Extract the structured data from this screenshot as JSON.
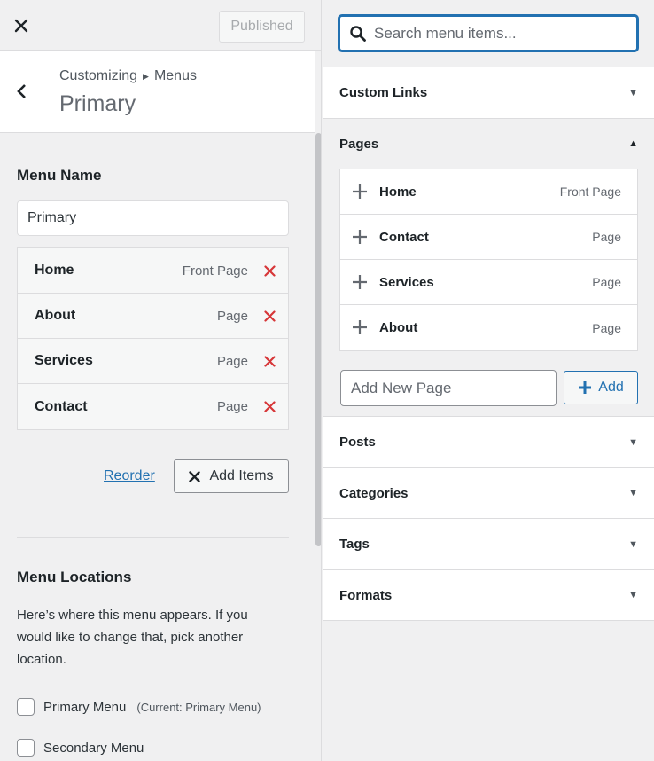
{
  "topbar": {
    "published_label": "Published"
  },
  "header": {
    "breadcrumb_root": "Customizing",
    "breadcrumb_current": "Menus",
    "title": "Primary"
  },
  "menu_name": {
    "heading": "Menu Name",
    "value": "Primary"
  },
  "menu_items": [
    {
      "label": "Home",
      "type": "Front Page"
    },
    {
      "label": "About",
      "type": "Page"
    },
    {
      "label": "Services",
      "type": "Page"
    },
    {
      "label": "Contact",
      "type": "Page"
    }
  ],
  "actions": {
    "reorder_label": "Reorder",
    "add_items_label": "Add Items"
  },
  "locations": {
    "heading": "Menu Locations",
    "description": "Here’s where this menu appears. If you would like to change that, pick another location.",
    "options": [
      {
        "label": "Primary Menu",
        "sub": "(Current: Primary Menu)"
      },
      {
        "label": "Secondary Menu",
        "sub": ""
      }
    ]
  },
  "search": {
    "placeholder": "Search menu items..."
  },
  "panels": {
    "custom_links": "Custom Links",
    "pages": "Pages",
    "posts": "Posts",
    "categories": "Categories",
    "tags": "Tags",
    "formats": "Formats"
  },
  "available_pages": [
    {
      "label": "Home",
      "type": "Front Page"
    },
    {
      "label": "Contact",
      "type": "Page"
    },
    {
      "label": "Services",
      "type": "Page"
    },
    {
      "label": "About",
      "type": "Page"
    }
  ],
  "new_page": {
    "placeholder": "Add New Page",
    "add_label": "Add"
  },
  "colors": {
    "accent": "#2271b1",
    "delete": "#d63638"
  }
}
